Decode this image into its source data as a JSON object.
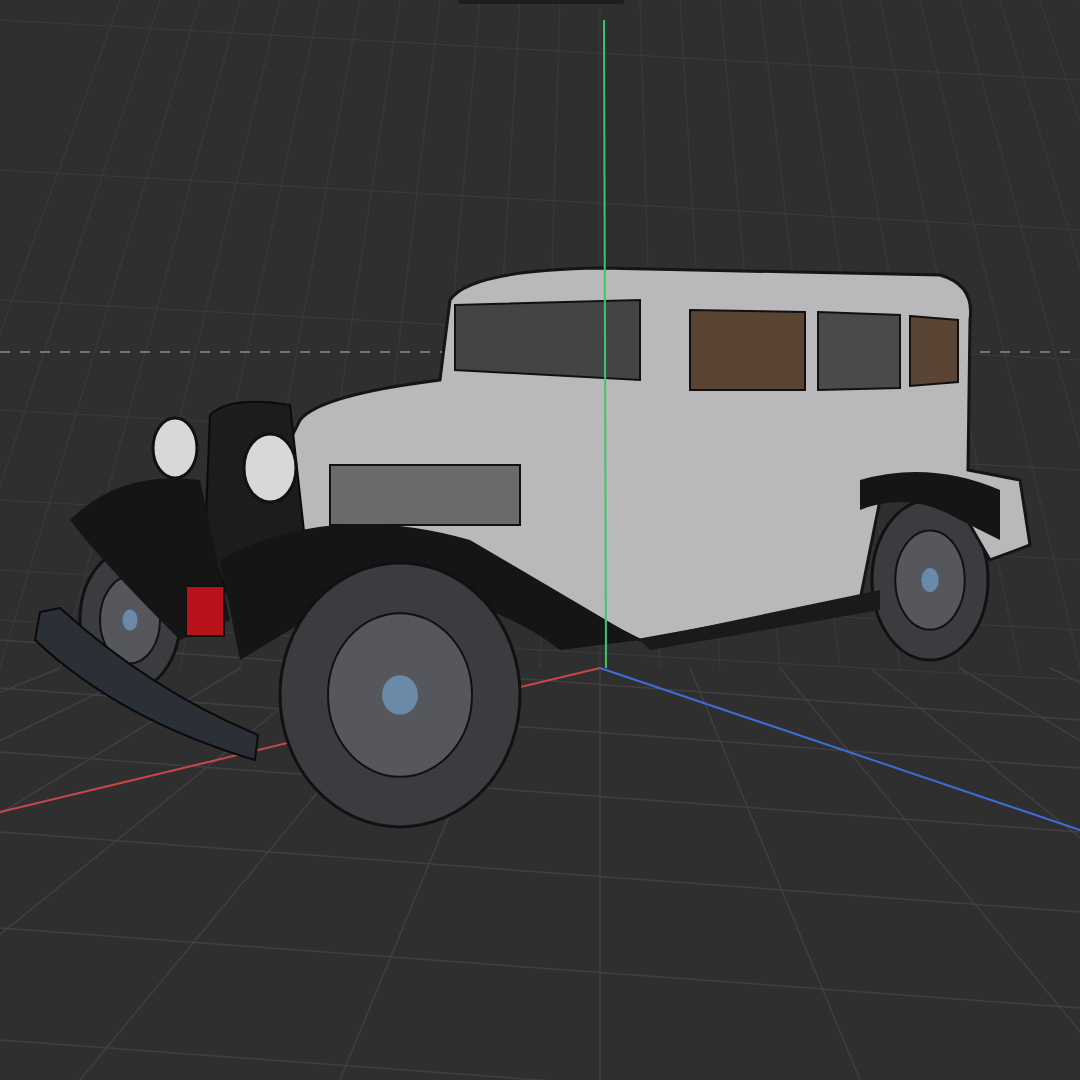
{
  "viewport": {
    "axes": [
      {
        "kind": "x",
        "color": "#c84848"
      },
      {
        "kind": "y",
        "color": "#3ec46a"
      },
      {
        "kind": "z",
        "color": "#3a6fd8"
      }
    ]
  }
}
